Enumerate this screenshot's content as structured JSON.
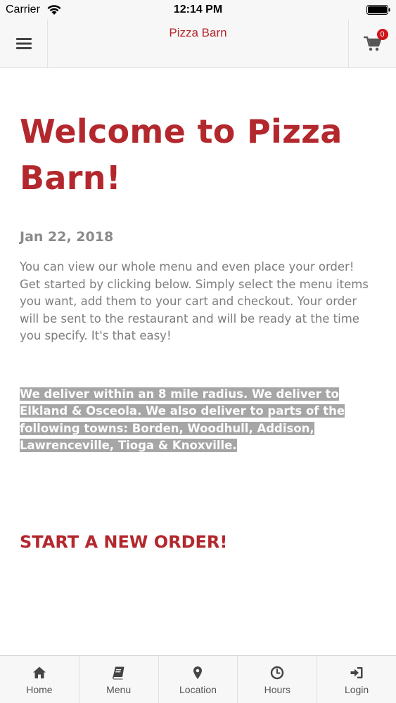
{
  "status_bar": {
    "carrier": "Carrier",
    "time": "12:14 PM",
    "icons": [
      "wifi-icon",
      "battery-icon"
    ]
  },
  "nav": {
    "title": "Pizza Barn",
    "cart_count": "0",
    "icons": [
      "hamburger-menu-icon",
      "cart-icon"
    ]
  },
  "content": {
    "title": "Welcome to Pizza Barn!",
    "date": "Jan 22, 2018",
    "intro": "You can view our whole menu and even place your order! Get started by clicking below. Simply select the menu items you want, add them to your cart and checkout. Your order will be sent to the restaurant and will be ready at the time you specify. It's that easy!",
    "delivery": "We deliver within an 8 mile radius.  We deliver to Elkland & Osceola.  We also deliver to parts of the following towns: Borden, Woodhull, Addison, Lawrenceville, Tioga & Knoxville.",
    "cta": "START A NEW ORDER!"
  },
  "tabs": [
    {
      "label": "Home",
      "icon": "home-icon"
    },
    {
      "label": "Menu",
      "icon": "book-icon"
    },
    {
      "label": "Location",
      "icon": "map-pin-icon"
    },
    {
      "label": "Hours",
      "icon": "clock-icon"
    },
    {
      "label": "Login",
      "icon": "login-icon"
    }
  ],
  "colors": {
    "brand": "#b3282d",
    "badge": "#d0131a",
    "highlight": "#a6a6a6",
    "bar_bg": "#f7f7f7"
  }
}
